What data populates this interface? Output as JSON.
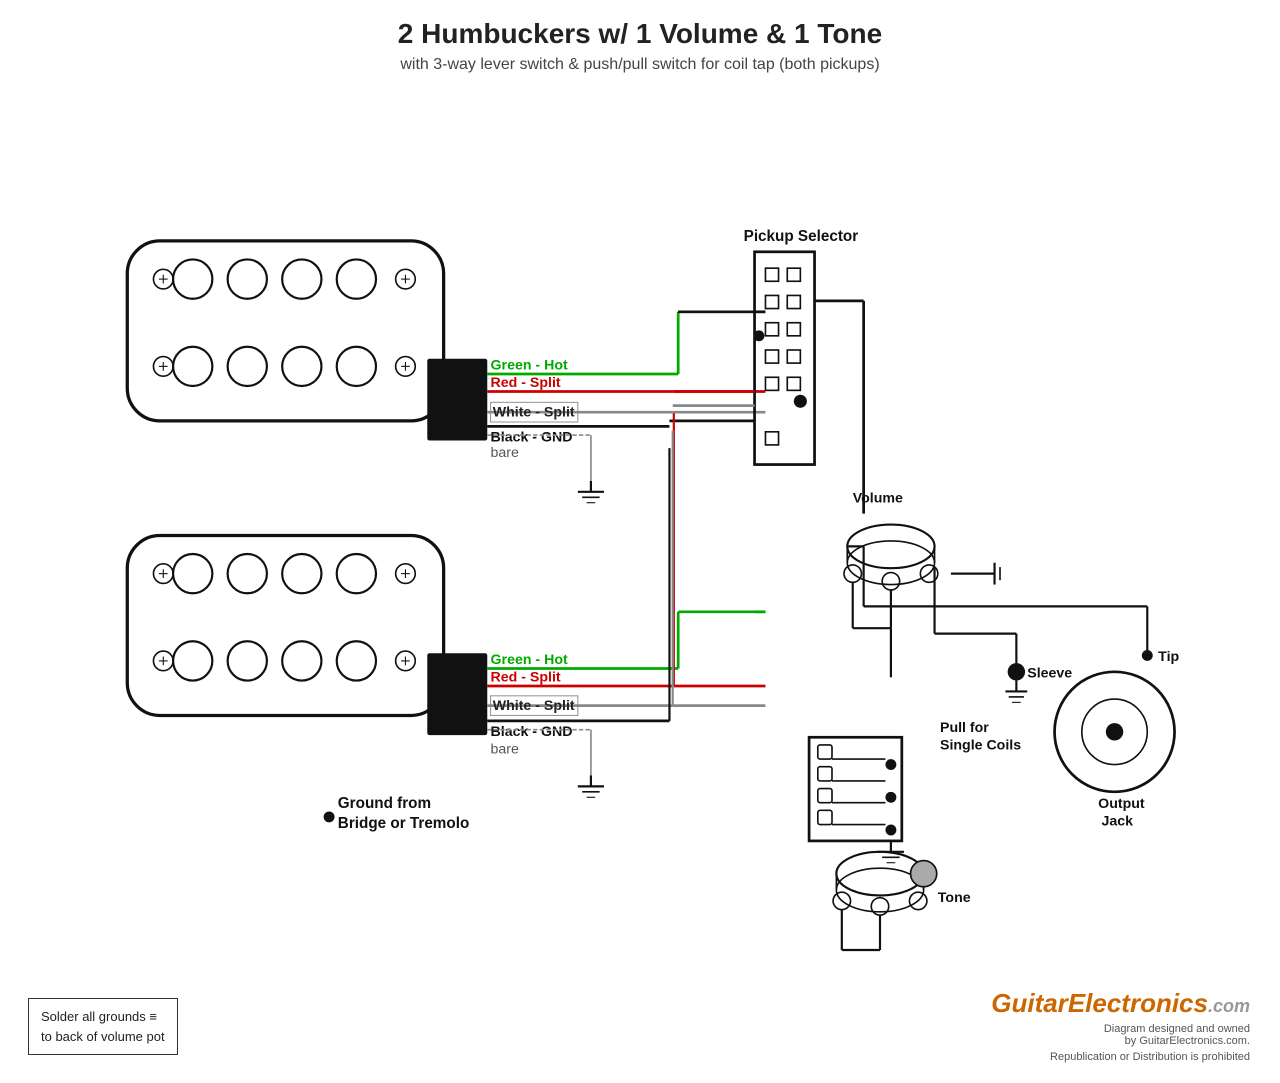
{
  "header": {
    "main_title": "2 Humbuckers w/ 1 Volume & 1 Tone",
    "subtitle": "with 3-way lever switch & push/pull switch for coil tap (both pickups)"
  },
  "labels": {
    "green_hot": "Green - Hot",
    "red_split": "Red - Split",
    "white_split": "White - Split",
    "black_gnd": "Black - GND",
    "bare": "bare",
    "pickup_selector": "Pickup Selector",
    "volume": "Volume",
    "tone": "Tone",
    "pull_single": "Pull for\nSingle Coils",
    "sleeve": "Sleeve",
    "tip": "Tip",
    "output_jack": "Output\nJack",
    "ground_from": "Ground from\nBridge or Tremolo"
  },
  "footer": {
    "solder_note": "Solder all grounds ≡\nto back of volume pot",
    "brand": "GuitarElectronics",
    "brand_suffix": ".com",
    "diagram_credit": "Diagram designed and owned\nby GuitarElectronics.com.",
    "copyright": "Republication or Distribution is prohibited"
  },
  "colors": {
    "green": "#00aa00",
    "red": "#cc0000",
    "white_bg": "#ffffff",
    "black": "#111111",
    "gray": "#888888",
    "orange": "#cc6600"
  }
}
